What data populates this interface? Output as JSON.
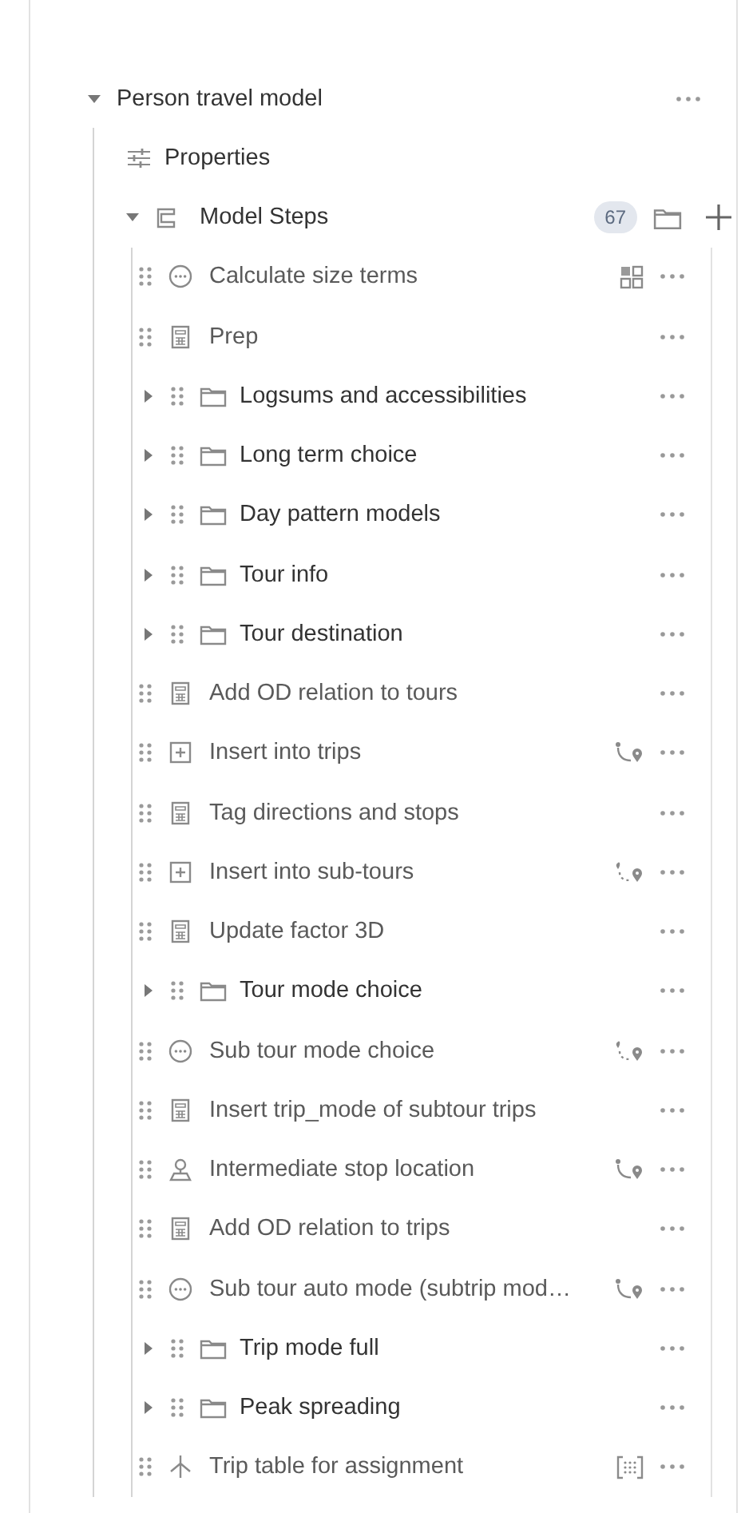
{
  "root": {
    "label": "Person travel model",
    "expanded": true
  },
  "properties": {
    "label": "Properties"
  },
  "model_steps": {
    "label": "Model Steps",
    "expanded": true,
    "count": "67"
  },
  "steps": [
    {
      "kind": "script",
      "label": "Calculate size terms"
    },
    {
      "kind": "calc",
      "label": "Prep"
    },
    {
      "kind": "group",
      "expanded": false,
      "label": "Logsums and accessibilities"
    },
    {
      "kind": "group",
      "expanded": false,
      "label": "Long term choice"
    },
    {
      "kind": "group",
      "expanded": false,
      "label": "Day pattern models"
    },
    {
      "kind": "group",
      "expanded": false,
      "label": "Tour info"
    },
    {
      "kind": "group",
      "expanded": false,
      "label": "Tour destination"
    },
    {
      "kind": "calc",
      "label": "Add OD relation to tours"
    },
    {
      "kind": "insert",
      "label": "Insert into trips"
    },
    {
      "kind": "calc",
      "label": "Tag directions and stops"
    },
    {
      "kind": "insert",
      "label": "Insert into sub-tours"
    },
    {
      "kind": "calc",
      "label": "Update factor 3D"
    },
    {
      "kind": "group",
      "expanded": false,
      "label": "Tour mode choice"
    },
    {
      "kind": "script",
      "label": "Sub tour mode choice"
    },
    {
      "kind": "calc",
      "label": "Insert trip_mode of subtour trips"
    },
    {
      "kind": "location",
      "label": "Intermediate stop location"
    },
    {
      "kind": "calc",
      "label": "Add OD relation to trips"
    },
    {
      "kind": "script",
      "label": "Sub tour auto mode (subtrip mod…"
    },
    {
      "kind": "group",
      "expanded": false,
      "label": "Trip mode full"
    },
    {
      "kind": "group",
      "expanded": false,
      "label": "Peak spreading"
    },
    {
      "kind": "split",
      "label": "Trip table for assignment"
    }
  ]
}
